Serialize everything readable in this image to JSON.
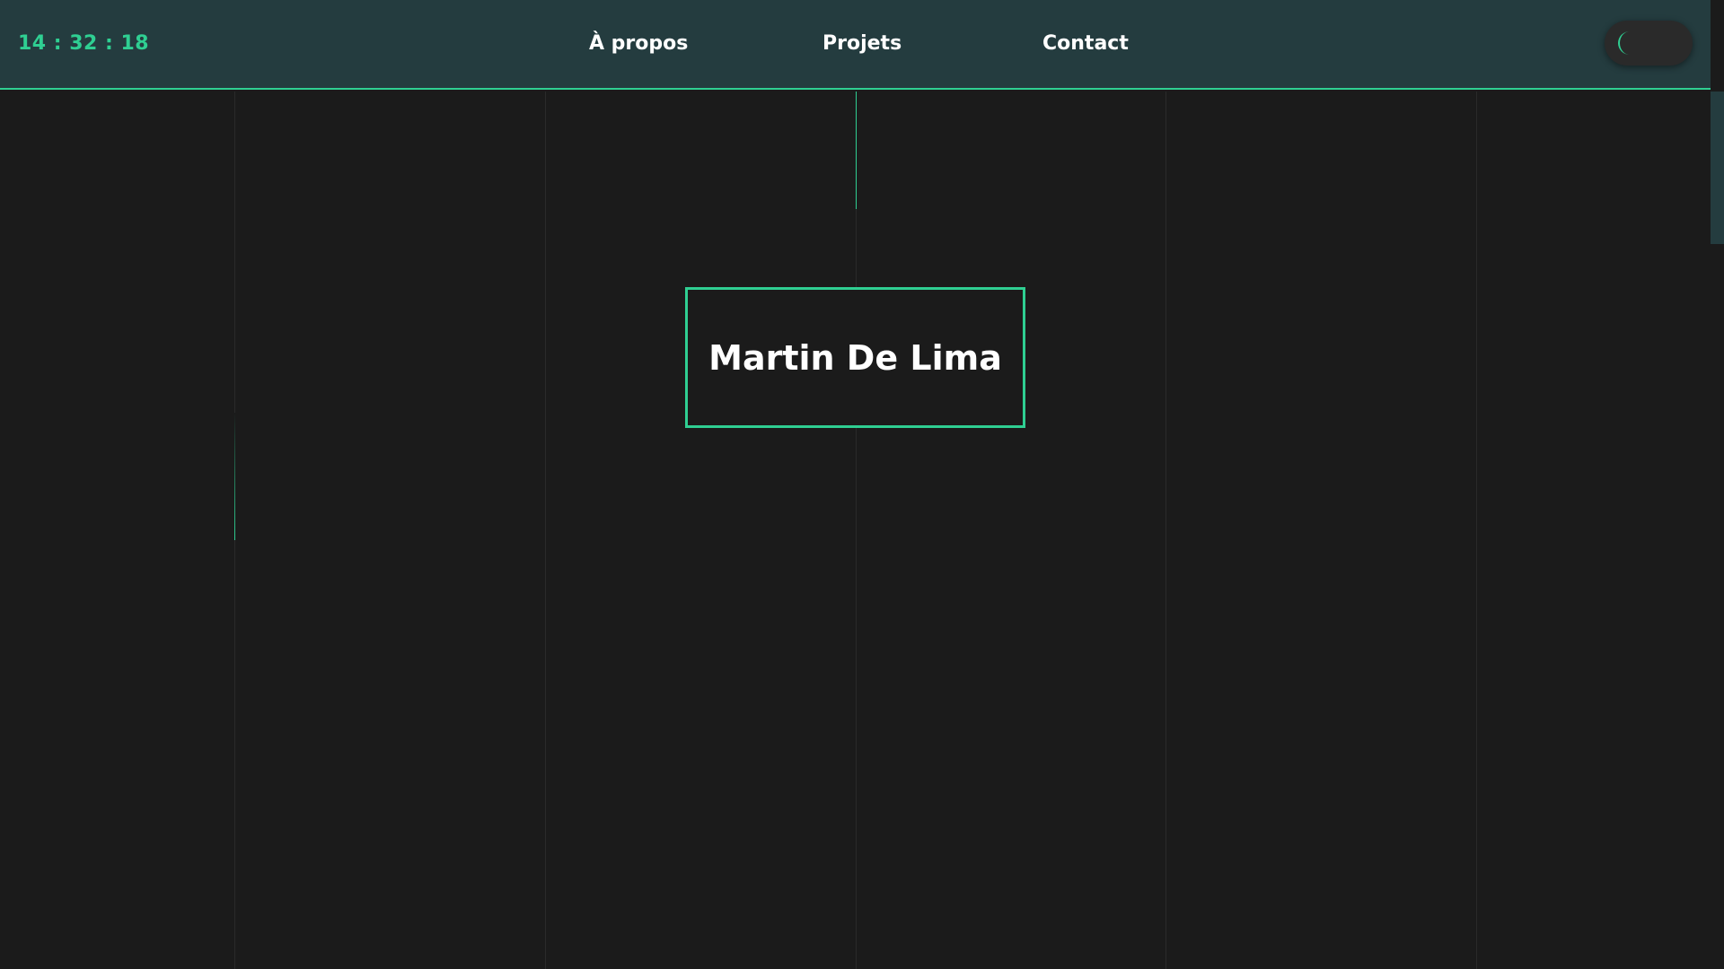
{
  "header": {
    "clock": "14 : 32 : 18",
    "nav": [
      {
        "label": "À propos"
      },
      {
        "label": "Projets"
      },
      {
        "label": "Contact"
      }
    ],
    "theme_toggle": {
      "icon": "moon-icon",
      "state": "dark"
    }
  },
  "hero": {
    "name": "Martin De Lima"
  },
  "colors": {
    "accent": "#2fcf92",
    "header_bg": "#243c3f",
    "page_bg": "#1b1b1b",
    "text": "#ffffff"
  }
}
